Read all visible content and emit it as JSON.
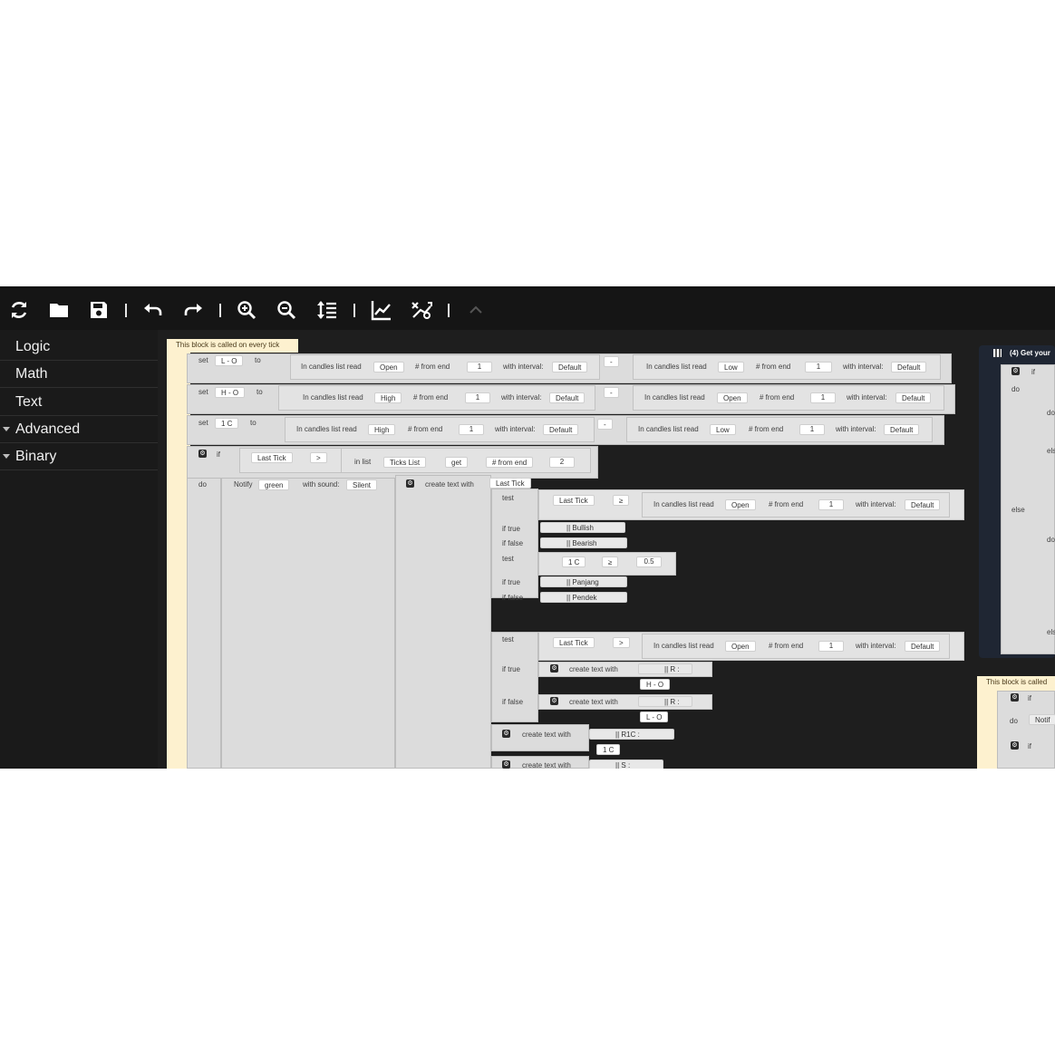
{
  "toolbar": {
    "icons": [
      "reset-icon",
      "open-icon",
      "save-icon",
      "undo-icon",
      "redo-icon",
      "zoom-in-icon",
      "zoom-out-icon",
      "sort-icon",
      "chart-icon",
      "strategy-icon",
      "collapse-icon"
    ]
  },
  "toolbox": {
    "categories": [
      {
        "label": "Logic"
      },
      {
        "label": "Math"
      },
      {
        "label": "Text"
      },
      {
        "label": "Advanced"
      },
      {
        "label": "Binary"
      }
    ]
  },
  "block": {
    "hat": "This block is called on every tick",
    "set": "set",
    "to": "to",
    "if": "if",
    "do": "do",
    "test": "test",
    "if_true": "if true",
    "if_false": "if false",
    "in_list": "in list",
    "candles": "In candles list read",
    "from_end_lbl": "# from end",
    "interval_lbl": "with interval:",
    "default": "Default",
    "minus": "-",
    "one": "1",
    "two": "2",
    "half": "0.5",
    "lo": "L - O",
    "ho": "H - O",
    "oc": "1 C",
    "open": "Open",
    "low": "Low",
    "high": "High",
    "last_tick": "Last Tick",
    "gt": ">",
    "gte": "≥",
    "ticks_list": "Ticks List",
    "get": "get",
    "from_end_dd": "# from end",
    "notify": "Notify",
    "green": "green",
    "with_sound": "with sound:",
    "silent": "Silent",
    "create_text": "create text with",
    "bullish": "|| Bullish",
    "bearish": "|| Bearish",
    "panjang": "|| Panjang",
    "pendek": "|| Pendek",
    "r": "|| R :",
    "r1c": "|| R1C :",
    "s": "|| S :"
  },
  "right_block": {
    "title": "(4) Get your",
    "if": "if",
    "do": "do",
    "do_cut": "do",
    "else": "else",
    "else_cut": "els",
    "else_cut2": "els"
  },
  "right_block2": {
    "hat": "This block is called",
    "if": "if",
    "do": "do",
    "notify_cut": "Notif"
  }
}
